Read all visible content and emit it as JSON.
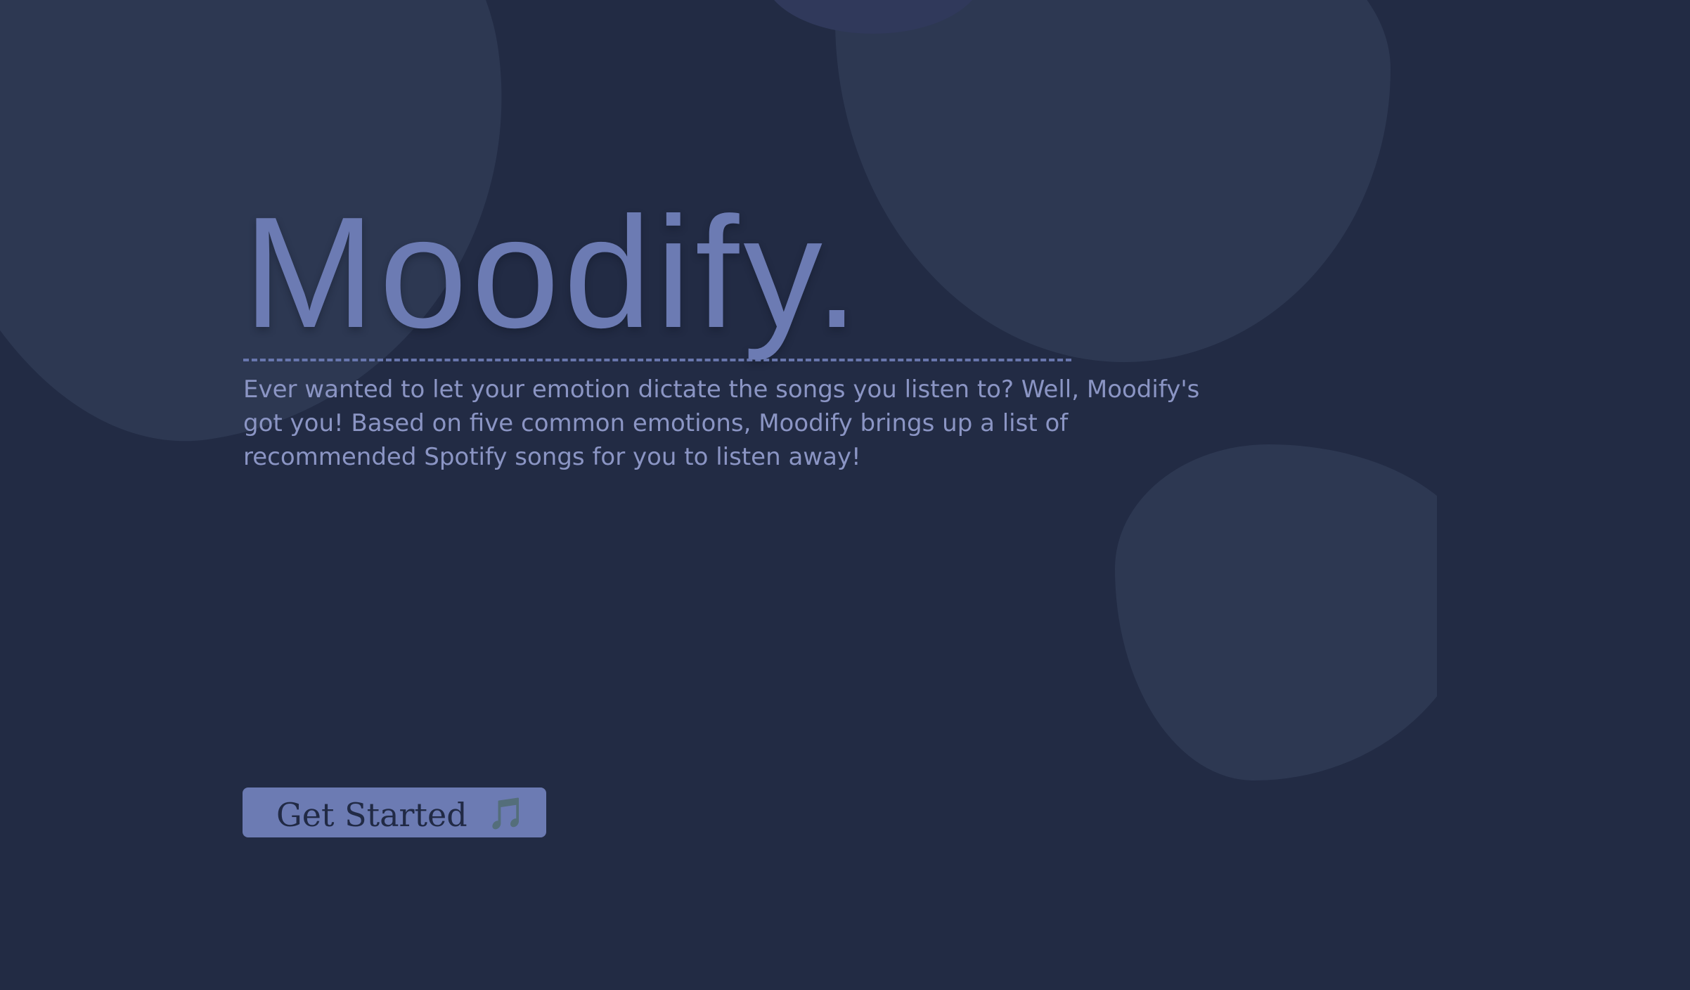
{
  "hero": {
    "title": "Moodify.",
    "divider": "------------------------------------------------------------------",
    "description": "Ever wanted to let your emotion dictate the songs you listen to? Well, Moodify's got you! Based on five common emotions, Moodify brings up a list of recommended Spotify songs for you to listen away!"
  },
  "cta": {
    "label": "Get Started",
    "icon": "music-note-icon",
    "icon_glyph": "🎵"
  },
  "colors": {
    "background": "#222b44",
    "blob": "#2d3852",
    "accent": "#6c7bb3",
    "text": "#8b95c4",
    "button_text": "#212a45"
  }
}
